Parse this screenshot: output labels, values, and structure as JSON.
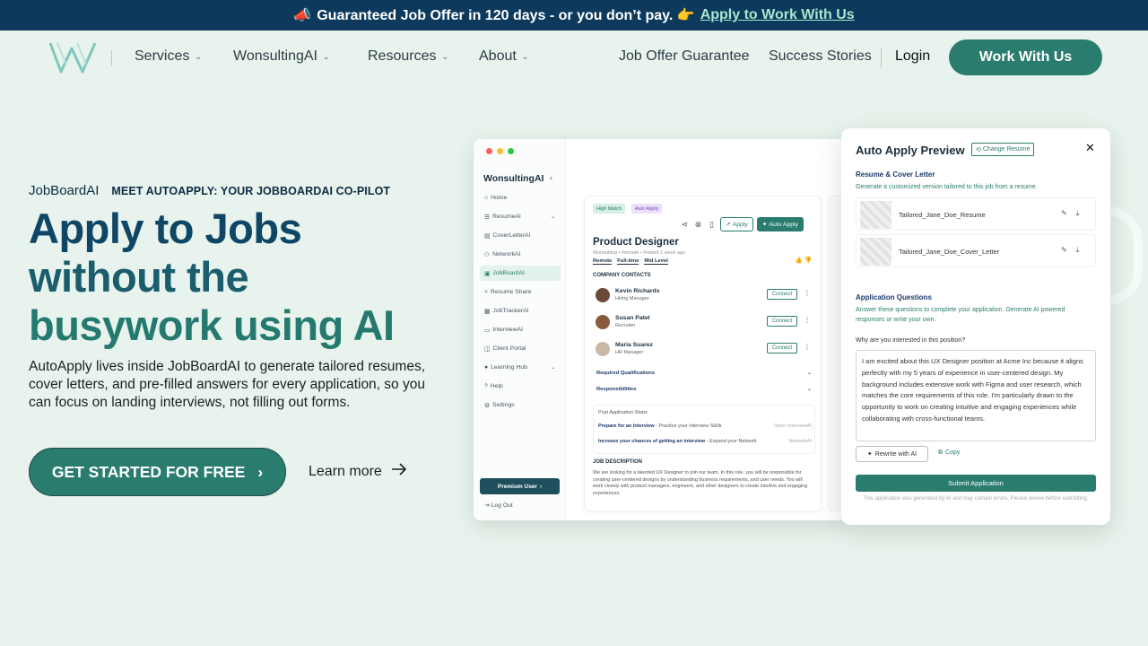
{
  "banner": {
    "emoji": "📣",
    "text": "Guaranteed Job Offer in 120 days - or you don’t pay. 👉",
    "link": "Apply to Work With Us"
  },
  "nav": {
    "menus": [
      "Services",
      "WonsultingAI",
      "Resources",
      "About"
    ],
    "links": [
      "Job Offer Guarantee",
      "Success Stories"
    ],
    "login": "Login",
    "cta": "Work With Us"
  },
  "hero": {
    "brand": "JobBoardAI",
    "eyebrow": "MEET AUTOAPPLY: YOUR JOBBOARDAI CO-PILOT",
    "headline": [
      "Apply to Jobs",
      "without the",
      "busywork using AI"
    ],
    "description": "AutoApply lives inside JobBoardAI to generate tailored resumes, cover letters, and pre-filled answers for every application, so you can focus on landing interviews, not filling out forms.",
    "primary_cta": "GET STARTED FOR FREE",
    "secondary_cta": "Learn more"
  },
  "app": {
    "logo": "WonsultingAI",
    "sidebar": [
      "Home",
      "ResumeAI",
      "CoverLetterAI",
      "NetworkAI",
      "JobBoardAI",
      "Resume Share",
      "JobTrackerAI",
      "InterviewAI",
      "Client Portal",
      "Learning Hub",
      "Help",
      "Settings"
    ],
    "active_item": "JobBoardAI",
    "premium": "Premium User",
    "logout": "Log Out",
    "job": {
      "tags": [
        "High Match",
        "Auto Apply"
      ],
      "apply": "Apply",
      "auto_apply": "Auto Apply",
      "title": "Product Designer",
      "meta": "Wonsulting • Remote • Posted 1 week ago",
      "chips": [
        "Remote",
        "Full-time",
        "Mid Level"
      ],
      "contacts_heading": "COMPANY CONTACTS",
      "contacts": [
        {
          "name": "Kevin Richards",
          "role": "Hiring Manager"
        },
        {
          "name": "Susan Patel",
          "role": "Recruiter"
        },
        {
          "name": "Maria Suarez",
          "role": "HR Manager"
        }
      ],
      "connect": "Connect",
      "accordions": [
        "Required Qualifications",
        "Responsibilities"
      ],
      "steps_title": "Post Application Steps",
      "steps": [
        {
          "bold": "Prepare for an Interview",
          "rest": " - Practice your Interview Skills",
          "right": "Open InterviewAI"
        },
        {
          "bold": "Increase your chances of getting an interview",
          "rest": " - Expand your Network",
          "right": "NetworkAI"
        }
      ],
      "jd_heading": "JOB DESCRIPTION",
      "jd": "We are looking for a talented UX Designer to join our team. In this role, you will be responsible for creating user-centered designs by understanding business requirements, and user needs. You will work closely with product managers, engineers, and other designers to create intuitive and engaging experiences."
    }
  },
  "panel": {
    "title": "Auto Apply Preview",
    "change_resume": "Change Resume",
    "docs_heading": "Resume & Cover Letter",
    "docs_sub": "Generate a customized version tailored to this job from a resume.",
    "files": [
      "Tailored_Jane_Doe_Resume",
      "Tailored_Jane_Doe_Cover_Letter"
    ],
    "questions_heading": "Application Questions",
    "questions_sub": "Answer these questions to complete your application. Generate AI powered responses or write your own.",
    "question": "Why are you interested in this position?",
    "answer": "I am excited about this UX Designer position at Acme Inc because it aligns perfectly with my 5 years of experience in user-centered design. My background includes extensive work with Figma and user research, which matches the core requirements of this role. I'm particularly drawn to the opportunity to work on creating intuitive and engaging experiences while collaborating with cross-functional teams.",
    "rewrite": "Rewrite with AI",
    "copy": "Copy",
    "submit": "Submit Application",
    "disclaimer": "This application was generated by AI and may contain errors. Please review before submitting."
  },
  "colors": {
    "banner": "#0d3a5c",
    "brand": "#2a7c6e",
    "background": "#e7f3ec"
  }
}
